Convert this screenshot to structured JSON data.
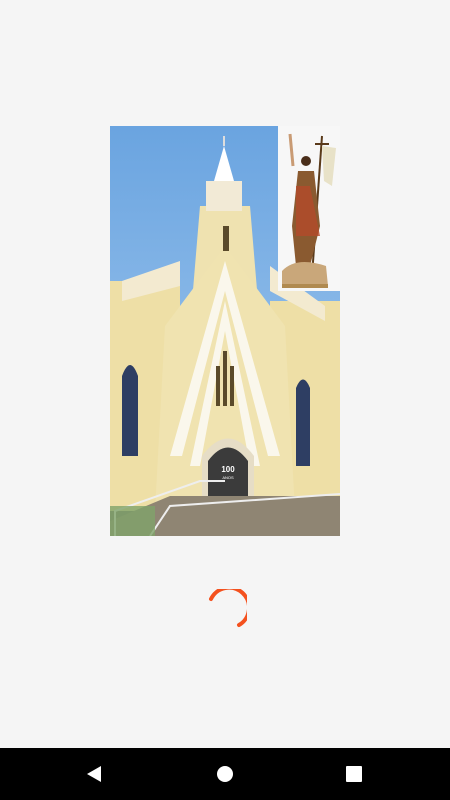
{
  "splash": {
    "image": {
      "description_icon": "church-with-saint-statue-image",
      "banner_text": "100",
      "banner_subtext": "ANOS"
    },
    "loader": {
      "icon": "loading-spinner-icon",
      "color": "#f4511e"
    }
  },
  "navigation_bar": {
    "back_icon": "back-triangle-icon",
    "home_icon": "home-circle-icon",
    "recents_icon": "recents-square-icon"
  },
  "colors": {
    "background": "#f5f5f5",
    "navbar": "#000000",
    "accent": "#f4511e"
  }
}
